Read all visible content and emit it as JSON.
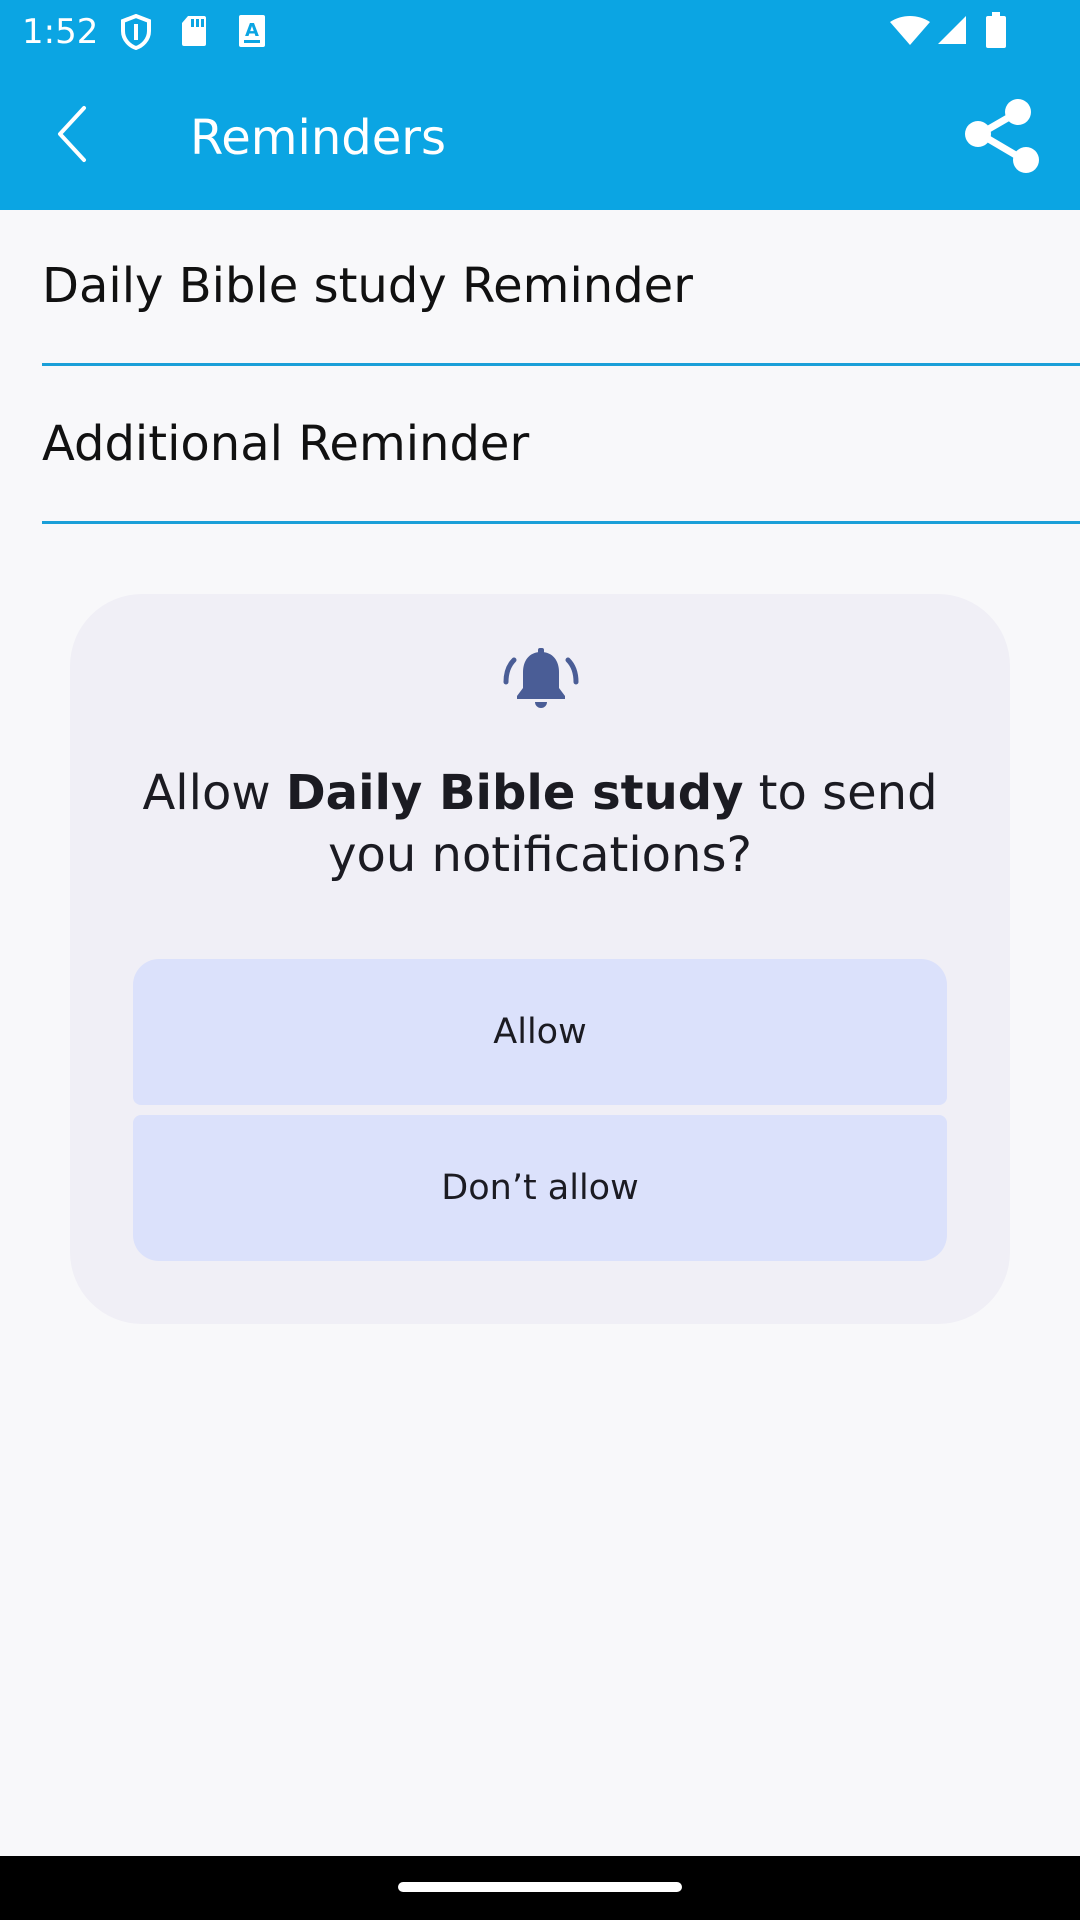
{
  "status_bar": {
    "time": "1:52",
    "icons": [
      "shield-icon",
      "sd-card-icon",
      "font-a-icon",
      "wifi-icon",
      "cell-signal-icon",
      "battery-icon"
    ]
  },
  "app_bar": {
    "title": "Reminders",
    "back_icon": "chevron-left-icon",
    "share_icon": "share-icon",
    "color": "#0ba5e3"
  },
  "list": {
    "items": [
      {
        "label": "Daily Bible study Reminder"
      },
      {
        "label": "Additional Reminder"
      }
    ]
  },
  "permission_dialog": {
    "icon": "bell-ringing-icon",
    "text_before": "Allow ",
    "app_name": "Daily Bible study",
    "text_after": " to send you notifications?",
    "allow_label": "Allow",
    "deny_label": "Don’t allow"
  }
}
